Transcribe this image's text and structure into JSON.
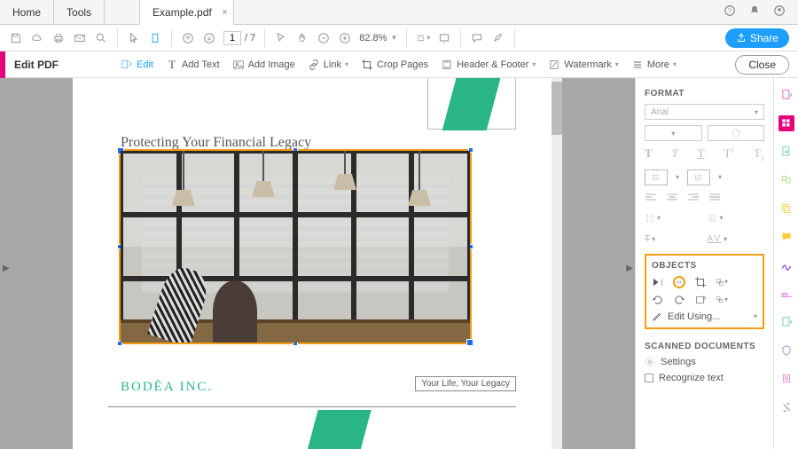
{
  "tabs": {
    "home": "Home",
    "tools": "Tools",
    "doc": "Example.pdf"
  },
  "toolbar": {
    "page_current": "1",
    "page_total": "/  7",
    "zoom": "82.8%"
  },
  "share": "Share",
  "editbar": {
    "label": "Edit PDF",
    "edit": "Edit",
    "addtext": "Add Text",
    "addimage": "Add Image",
    "link": "Link",
    "crop": "Crop Pages",
    "header": "Header & Footer",
    "watermark": "Watermark",
    "more": "More",
    "close": "Close"
  },
  "page": {
    "title": "Protecting Your Financial Legacy",
    "tagline": "Your Life, Your Legacy",
    "company": "BODĒA INC."
  },
  "panel": {
    "format": "FORMAT",
    "font": "Arial",
    "objects": "OBJECTS",
    "editusing": "Edit Using...",
    "scanned": "SCANNED DOCUMENTS",
    "settings": "Settings",
    "recognize": "Recognize text"
  }
}
